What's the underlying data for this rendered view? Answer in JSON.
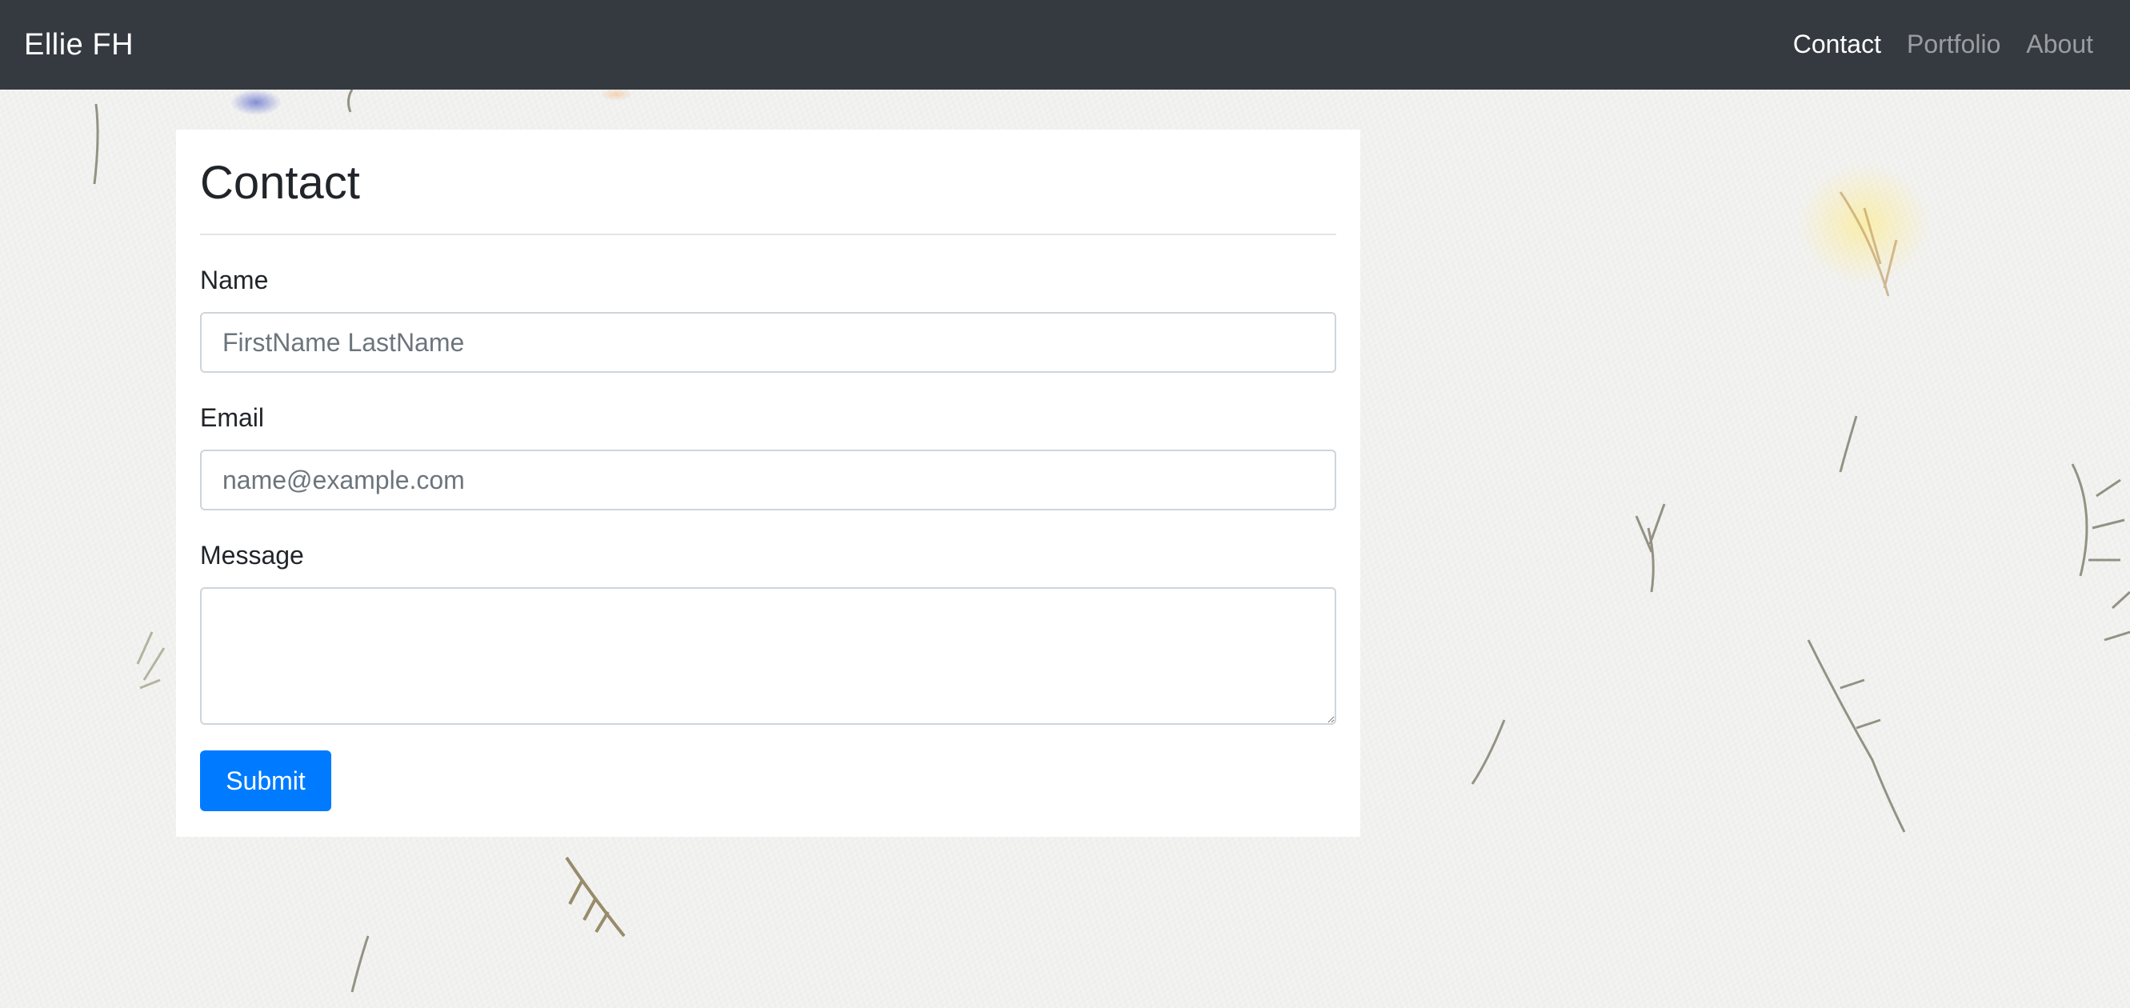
{
  "navbar": {
    "brand": "Ellie FH",
    "links": [
      {
        "label": "Contact",
        "active": true
      },
      {
        "label": "Portfolio",
        "active": false
      },
      {
        "label": "About",
        "active": false
      }
    ]
  },
  "contact_form": {
    "title": "Contact",
    "name": {
      "label": "Name",
      "placeholder": "FirstName LastName",
      "value": ""
    },
    "email": {
      "label": "Email",
      "placeholder": "name@example.com",
      "value": ""
    },
    "message": {
      "label": "Message",
      "value": ""
    },
    "submit_label": "Submit"
  },
  "colors": {
    "navbar_bg": "#343a40",
    "primary": "#007bff",
    "background": "#f3f3f2"
  }
}
